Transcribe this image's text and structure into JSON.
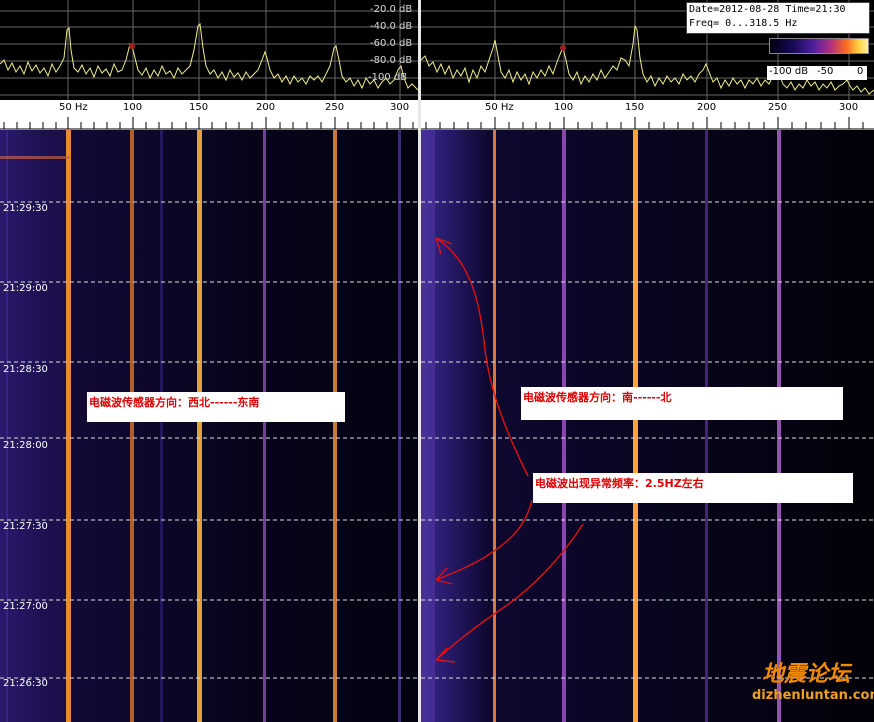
{
  "left_panel": {
    "db_labels": [
      "-20.0 dB",
      "-40.0 dB",
      "-60.0 dB",
      "-80.0 dB",
      "-100 dB"
    ],
    "hz_labels": [
      "50 Hz",
      "100",
      "150",
      "200",
      "250",
      "300"
    ],
    "time_labels": [
      "21:29:30",
      "21:29:00",
      "21:28:30",
      "21:28:00",
      "21:27:30",
      "21:27:00",
      "21:26:30"
    ]
  },
  "right_panel": {
    "hz_labels": [
      "50 Hz",
      "100",
      "150",
      "200",
      "250",
      "300"
    ]
  },
  "info": {
    "line1": "Date=2012-08-28 Time=21:30",
    "line2": "Freq= 0...318.5 Hz"
  },
  "colorbar": {
    "labels": [
      "-100 dB",
      "-50",
      "0"
    ]
  },
  "annotations": {
    "left_direction": "电磁波传感器方向：西北------东南",
    "right_direction": "电磁波传感器方向：南------北",
    "anomaly": "电磁波出现异常频率：2.5HZ左右"
  },
  "watermark": {
    "logo_text": "地震论坛",
    "url_text": "dizhenluntan.com"
  },
  "colors": {
    "trace": "#f0ee8a",
    "line_orange": "#ffa238",
    "line_violet": "#a050c8",
    "annotation_red": "#dd1111",
    "watermark_orange": "#f08a00"
  }
}
